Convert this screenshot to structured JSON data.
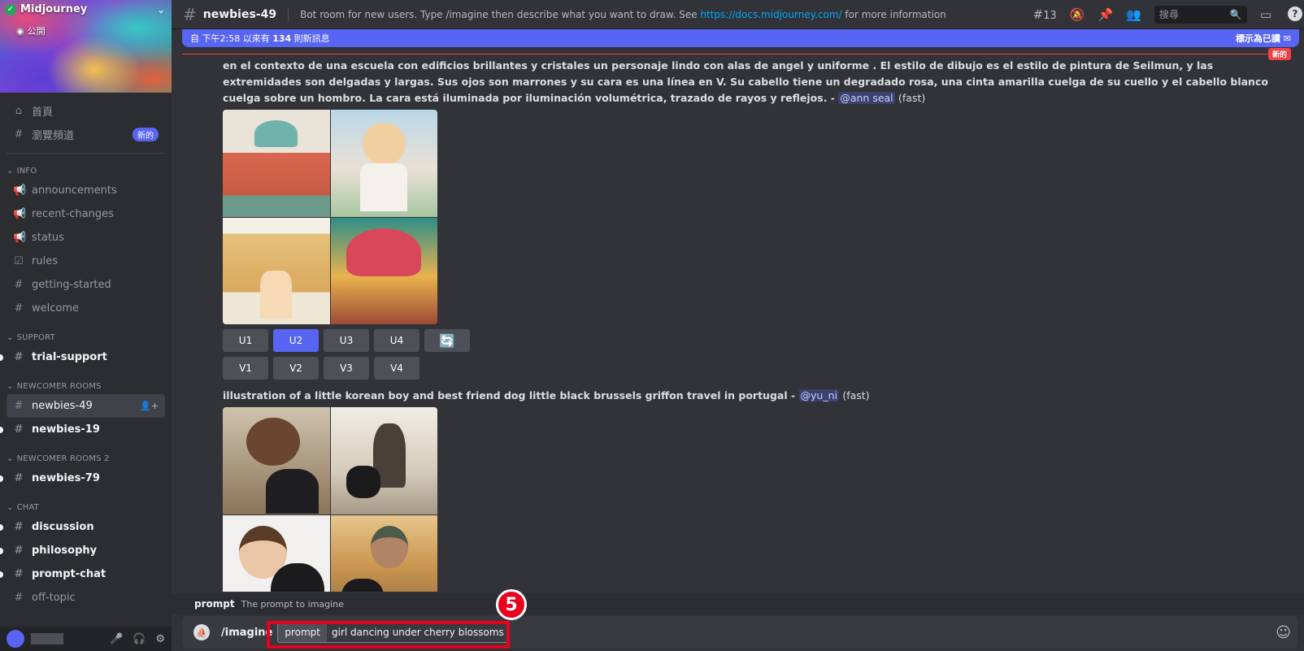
{
  "server": {
    "name": "Midjourney",
    "visibility": "公開"
  },
  "sidebar": {
    "top_items": [
      {
        "label": "首頁"
      },
      {
        "label": "瀏覽頻道",
        "badge": "新的"
      }
    ],
    "categories": {
      "info": "INFO",
      "support": "SUPPORT",
      "newcomer": "NEWCOMER ROOMS",
      "newcomer2": "NEWCOMER ROOMS 2",
      "chat": "CHAT"
    },
    "info_channels": [
      "announcements",
      "recent-changes",
      "status",
      "rules",
      "getting-started",
      "welcome"
    ],
    "support_channels": [
      "trial-support"
    ],
    "newcomer_channels": [
      "newbies-49",
      "newbies-19"
    ],
    "newcomer2_channels": [
      "newbies-79"
    ],
    "chat_channels": [
      "discussion",
      "philosophy",
      "prompt-chat",
      "off-topic"
    ]
  },
  "topbar": {
    "channel": "newbies-49",
    "topic_prefix": "Bot room for new users. Type /imagine then describe what you want to draw. See",
    "topic_link": "https://docs.midjourney.com/",
    "topic_suffix": "for more information",
    "thread_count": "13",
    "search_placeholder": "搜尋"
  },
  "new_messages": {
    "prefix": "自 下午2:58 以來有",
    "count": "134",
    "suffix": "則新訊息",
    "mark_read": "標示為已讀",
    "new_label": "新的"
  },
  "messages": [
    {
      "text": "en el contexto de una escuela con edificios brillantes y cristales un personaje lindo con alas de angel y uniforme . El estilo de dibujo es el estilo de pintura de Seilmun, y las extremidades son delgadas y largas. Sus ojos son marrones y su cara es una línea en V. Su cabello tiene un degradado rosa, una cinta amarilla cuelga de su cuello y el cabello blanco cuelga sobre un hombro. La cara está iluminada por iluminación volumétrica, trazado de rayos y reflejos. -",
      "mention": "@ann seal",
      "speed": "(fast)",
      "upscale_buttons": [
        "U1",
        "U2",
        "U3",
        "U4"
      ],
      "variation_buttons": [
        "V1",
        "V2",
        "V3",
        "V4"
      ]
    },
    {
      "text": "illustration of a little korean boy and best friend dog little black brussels griffon travel in portugal -",
      "mention": "@yu_ni",
      "speed": "(fast)"
    }
  ],
  "composer": {
    "hint_name": "prompt",
    "hint_desc": "The prompt to imagine",
    "command": "/imagine",
    "param_label": "prompt",
    "param_value": "girl dancing under cherry blossoms"
  },
  "annotation": {
    "step": "5",
    "color": "#e8001c"
  },
  "colors": {
    "accent": "#5865f2",
    "sidebar": "#2b2d31",
    "main": "#313338",
    "link": "#00a8fc"
  }
}
